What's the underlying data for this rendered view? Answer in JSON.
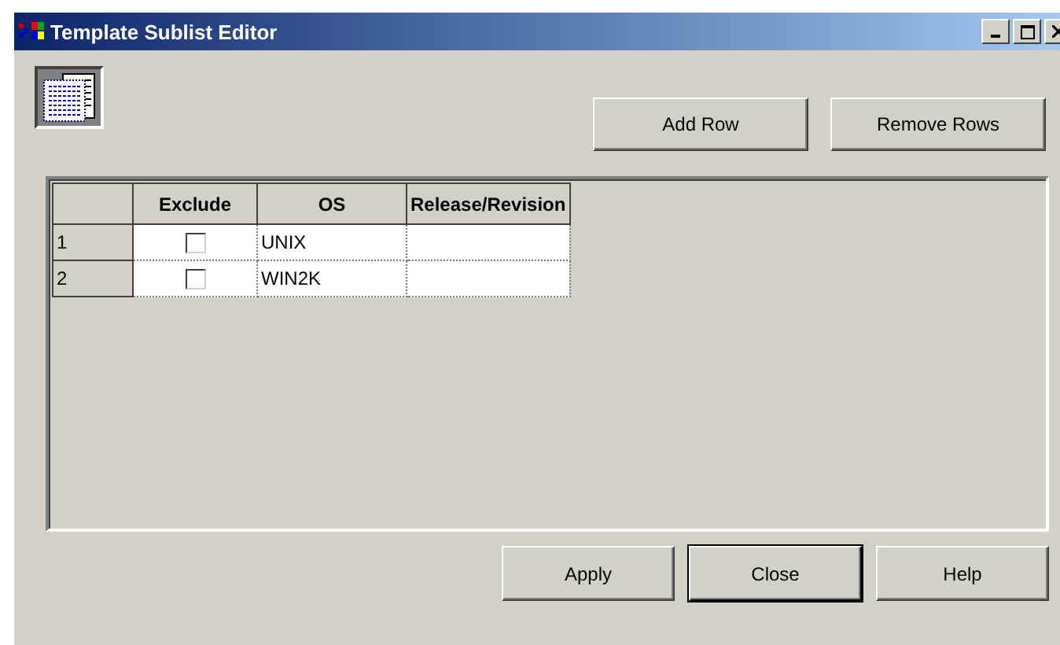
{
  "window": {
    "title": "Template Sublist Editor"
  },
  "toolbar_buttons": [
    {
      "label": "Add Row",
      "default": false
    },
    {
      "label": "Remove Rows",
      "default": false
    }
  ],
  "table": {
    "columns": [
      "Exclude",
      "OS",
      "Release/Revision"
    ],
    "rows": [
      {
        "number": "1",
        "exclude": false,
        "os": "UNIX"
      },
      {
        "number": "2",
        "exclude": false,
        "os": "WIN2K"
      }
    ]
  },
  "footer_buttons": [
    {
      "label": "Apply",
      "default": false
    },
    {
      "label": "Close",
      "default": true
    },
    {
      "label": "Help",
      "default": false
    }
  ]
}
